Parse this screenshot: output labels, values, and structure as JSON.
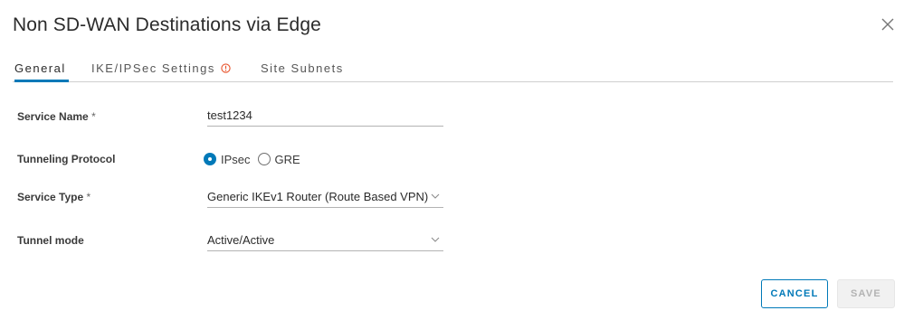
{
  "dialog": {
    "title": "Non SD-WAN Destinations via Edge",
    "close_icon": "close-icon"
  },
  "tabs": [
    {
      "label": "General",
      "active": true
    },
    {
      "label": "IKE/IPSec Settings",
      "active": false,
      "warning_icon": "warning-icon"
    },
    {
      "label": "Site Subnets",
      "active": false
    }
  ],
  "form": {
    "service_name": {
      "label": "Service Name",
      "required_mark": "*",
      "value": "test1234"
    },
    "tunneling_protocol": {
      "label": "Tunneling Protocol",
      "options": [
        {
          "label": "IPsec",
          "checked": true
        },
        {
          "label": "GRE",
          "checked": false
        }
      ]
    },
    "service_type": {
      "label": "Service Type",
      "required_mark": "*",
      "value": "Generic IKEv1 Router (Route Based VPN)"
    },
    "tunnel_mode": {
      "label": "Tunnel mode",
      "value": "Active/Active"
    }
  },
  "footer": {
    "cancel_label": "CANCEL",
    "save_label": "SAVE",
    "save_disabled": true
  },
  "colors": {
    "accent": "#0079b8",
    "warning": "#e8532b",
    "disabled_bg": "#f1f1f1",
    "disabled_text": "#b3b3b3"
  }
}
